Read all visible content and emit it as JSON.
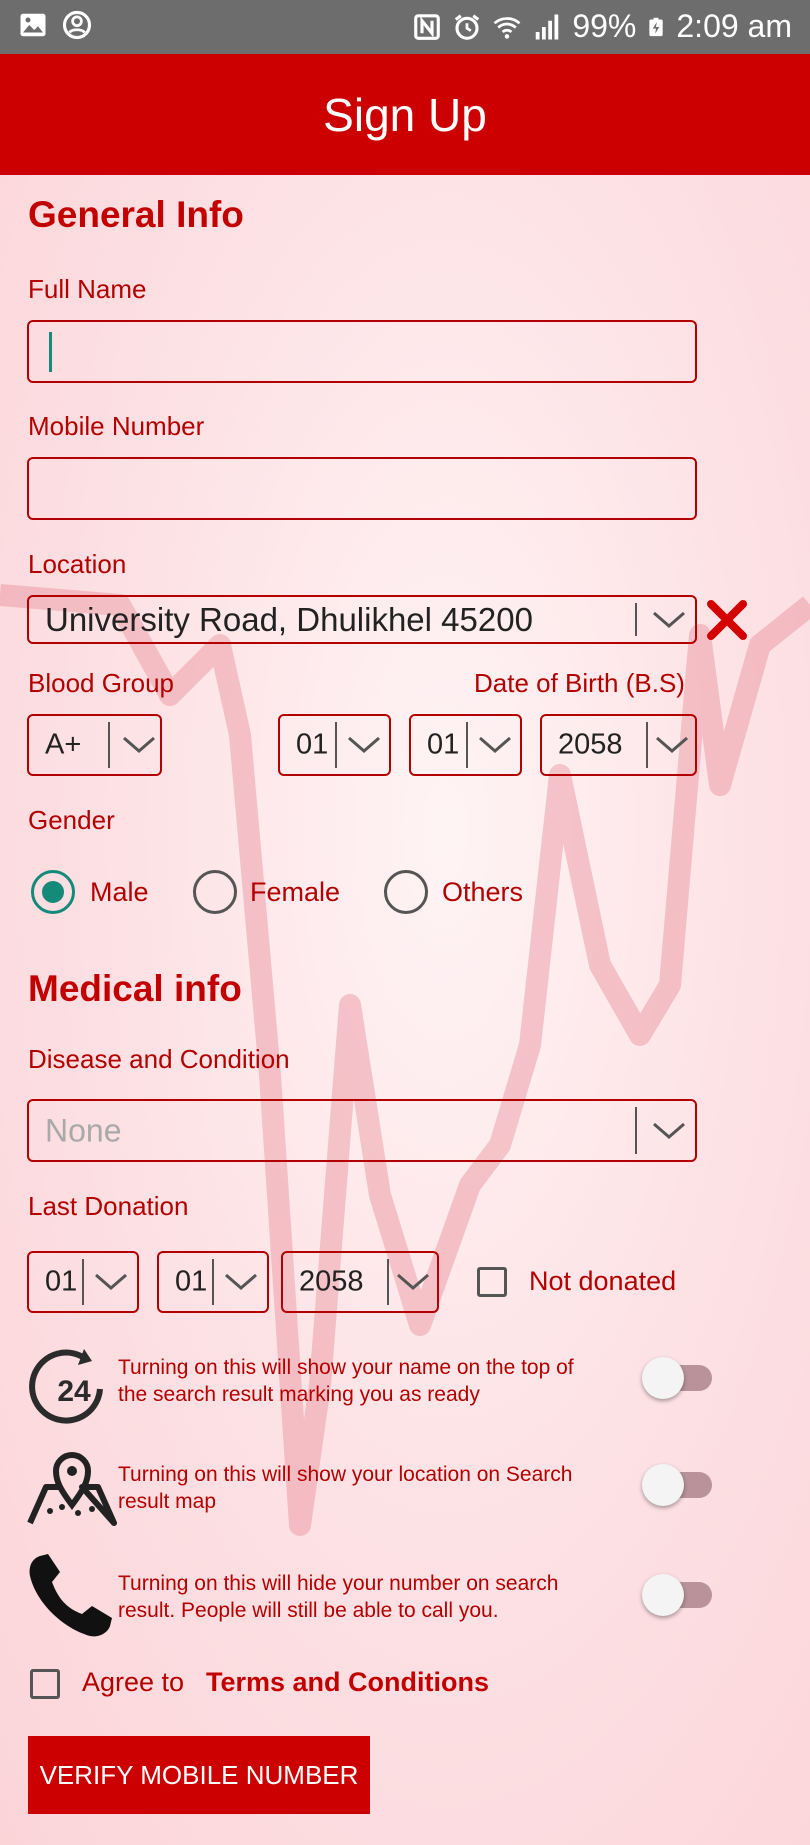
{
  "status_bar": {
    "battery": "99%",
    "time": "2:09 am",
    "icons": [
      "gallery-icon",
      "account-circle-icon",
      "nfc-icon",
      "alarm-icon",
      "wifi-icon",
      "signal-icon",
      "battery-charging-icon"
    ]
  },
  "app_bar": {
    "title": "Sign Up"
  },
  "general": {
    "title": "General Info",
    "full_name_label": "Full Name",
    "full_name_value": "",
    "mobile_label": "Mobile Number",
    "mobile_value": "",
    "location_label": "Location",
    "location_value": "University Road, Dhulikhel 45200",
    "blood_group_label": "Blood Group",
    "blood_group_value": "A+",
    "dob_label": "Date of Birth (B.S)",
    "dob_month": "01",
    "dob_day": "01",
    "dob_year": "2058",
    "gender_label": "Gender",
    "gender_options": [
      "Male",
      "Female",
      "Others"
    ],
    "gender_selected": "Male"
  },
  "medical": {
    "title": "Medical info",
    "disease_label": "Disease and Condition",
    "disease_placeholder": "None",
    "last_donation_label": "Last Donation",
    "ld_month": "01",
    "ld_day": "01",
    "ld_year": "2058",
    "not_donated_label": "Not donated",
    "not_donated_checked": false
  },
  "toggles": [
    {
      "icon": "24-hour-icon",
      "text_line1": "Turning on this will show your name on the top of",
      "text_line2": "the search result marking you as ready",
      "on": false
    },
    {
      "icon": "map-pin-icon",
      "text_line1": "Turning on this will show your location on Search",
      "text_line2": "result map",
      "on": false
    },
    {
      "icon": "phone-icon",
      "text_line1": "Turning on this will hide your number on search",
      "text_line2": "result. People will still be able to call you.",
      "on": false
    }
  ],
  "agree": {
    "prefix": "Agree to",
    "link": "Terms and Conditions",
    "checked": false
  },
  "verify_button": "VERIFY MOBILE NUMBER",
  "colors": {
    "primary": "#cc0000",
    "accent": "#138a7a",
    "label": "#b30000",
    "status_bar": "#6d6d6d"
  }
}
